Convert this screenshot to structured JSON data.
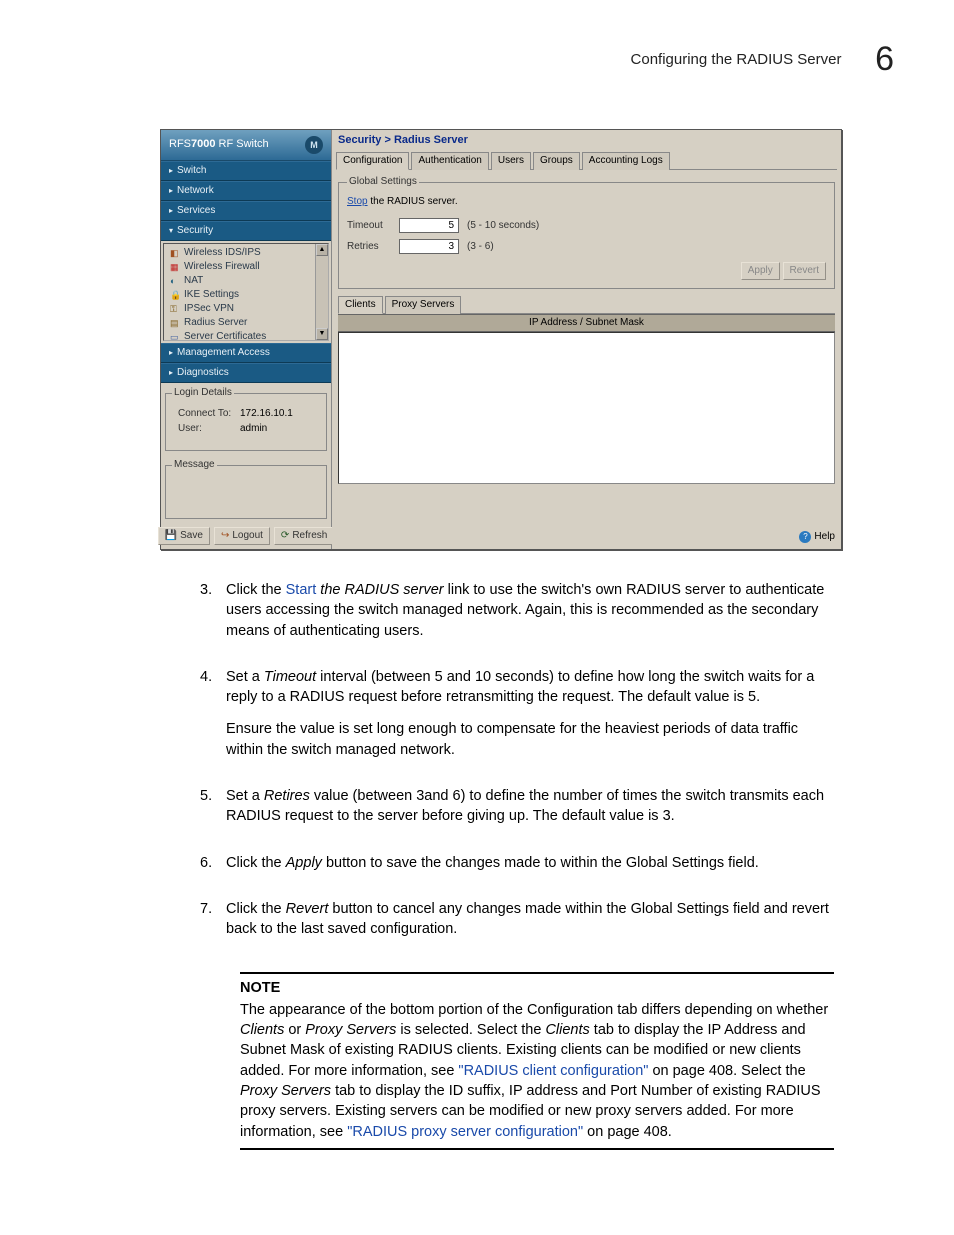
{
  "header": {
    "title": "Configuring the RADIUS Server",
    "chapter": "6"
  },
  "screenshot": {
    "sidebar": {
      "title_prefix": "RFS",
      "title_bold": "7000",
      "title_suffix": " RF Switch",
      "nav": {
        "switch": "Switch",
        "network": "Network",
        "services": "Services",
        "security": "Security",
        "management": "Management Access",
        "diagnostics": "Diagnostics"
      },
      "tree": [
        "Wireless IDS/IPS",
        "Wireless Firewall",
        "NAT",
        "IKE Settings",
        "IPSec VPN",
        "Radius Server",
        "Server Certificates"
      ],
      "login": {
        "legend": "Login Details",
        "connect_label": "Connect To:",
        "connect_value": "172.16.10.1",
        "user_label": "User:",
        "user_value": "admin"
      },
      "message_legend": "Message",
      "buttons": {
        "save": "Save",
        "logout": "Logout",
        "refresh": "Refresh"
      }
    },
    "main": {
      "breadcrumb": "Security > Radius Server",
      "tabs": [
        "Configuration",
        "Authentication",
        "Users",
        "Groups",
        "Accounting Logs"
      ],
      "active_tab": 0,
      "global": {
        "legend": "Global Settings",
        "stop_link": "Stop",
        "stop_text": " the RADIUS server.",
        "timeout_label": "Timeout",
        "timeout_value": "5",
        "timeout_hint": "(5 - 10 seconds)",
        "retries_label": "Retries",
        "retries_value": "3",
        "retries_hint": "(3 - 6)"
      },
      "buttons": {
        "apply": "Apply",
        "revert": "Revert"
      },
      "subtabs": [
        "Clients",
        "Proxy Servers"
      ],
      "active_subtab": 0,
      "table_header": "IP Address / Subnet Mask",
      "help_label": "Help"
    }
  },
  "instructions": [
    {
      "num": "3.",
      "html": "Click the <span class='blue'>Start</span> <em>the RADIUS server</em> link to use the switch's own RADIUS server to authenticate users accessing the switch managed network. Again, this is recommended as the secondary means of authenticating users."
    },
    {
      "num": "4.",
      "html": "Set a <em>Timeout</em> interval (between 5 and 10 seconds) to define how long the switch waits for a reply to a RADIUS request before retransmitting the request. The default value is 5.",
      "html2": "Ensure the value is set long enough to compensate for the heaviest periods of data traffic within the switch managed network."
    },
    {
      "num": "5.",
      "html": "Set a <em>Retires</em> value (between 3and 6) to define the number of times the switch transmits each RADIUS request to the server before giving up. The default value is 3."
    },
    {
      "num": "6.",
      "html": "Click the <em>Apply</em> button to save the changes made to within the Global Settings field."
    },
    {
      "num": "7.",
      "html": "Click the <em>Revert</em> button to cancel any changes made within the Global Settings field and revert back to the last saved configuration."
    }
  ],
  "note": {
    "label": "NOTE",
    "html": "The appearance of the bottom portion of the Configuration tab differs depending on whether <em>Clients</em> or <em>Proxy Servers</em> is selected. Select the <em>Clients</em> tab to display the IP Address and Subnet Mask of existing RADIUS clients. Existing clients can be modified or new clients added. For more information, see <span class='blue'>\"RADIUS client configuration\"</span> on page 408. Select the <em>Proxy Servers</em> tab to display the ID suffix, IP address and Port Number of existing RADIUS proxy servers. Existing servers can be modified or new proxy servers added. For more information, see <span class='blue'>\"RADIUS proxy server configuration\"</span> on page 408."
  }
}
